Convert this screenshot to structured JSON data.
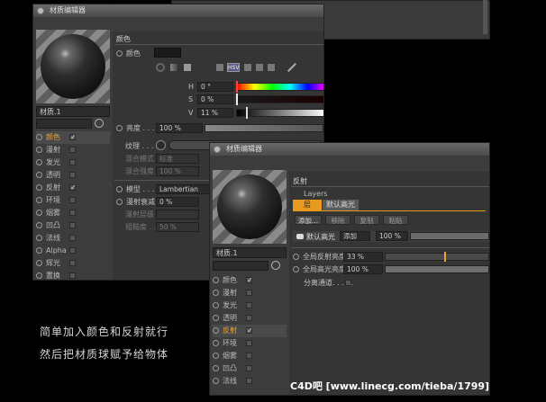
{
  "caption": {
    "line1": "简单加入颜色和反射就行",
    "line2": "然后把材质球赋予给物体"
  },
  "watermark": "C4D吧  [www.linecg.com/tieba/1799]",
  "colors": {
    "accent": "#e8a23a",
    "orange_tab": "#e89a1e"
  },
  "win1": {
    "title": "材质编辑器",
    "material_name": "材质.1",
    "channels": [
      {
        "label": "颜色",
        "checked": true,
        "on": true
      },
      {
        "label": "漫射",
        "checked": false,
        "on": false
      },
      {
        "label": "发光",
        "checked": false,
        "on": false
      },
      {
        "label": "透明",
        "checked": false,
        "on": false
      },
      {
        "label": "反射",
        "checked": true,
        "on": false
      },
      {
        "label": "环境",
        "checked": false,
        "on": false
      },
      {
        "label": "烟雾",
        "checked": false,
        "on": false
      },
      {
        "label": "凹凸",
        "checked": false,
        "on": false
      },
      {
        "label": "法线",
        "checked": false,
        "on": false
      },
      {
        "label": "Alpha",
        "checked": false,
        "on": false
      },
      {
        "label": "辉光",
        "checked": false,
        "on": false
      },
      {
        "label": "置换",
        "checked": false,
        "on": false
      }
    ],
    "section_title": "颜色",
    "color_label": "颜色",
    "hsv_label": "HSV",
    "h_label": "H",
    "h_value": "0 °",
    "s_label": "S",
    "s_value": "0 %",
    "v_label": "V",
    "v_value": "11 %",
    "brightness_label": "亮度 . . .",
    "brightness_value": "100 %",
    "texture_label": "纹理 . . . . .",
    "mix_mode_label": "混合模式",
    "mix_mode_value": "标准",
    "mix_strength_label": "混合强度",
    "mix_strength_value": "100 %",
    "model_label": "模型 . . .",
    "model_value": "Lambertian",
    "diffuse_falloff_label": "漫射衰减",
    "diffuse_falloff_value": "0 %",
    "diffuse_level_label": "漫射层级",
    "roughness_label": "粗糙度 . .",
    "roughness_value": "50 %"
  },
  "win2": {
    "title": "材质编辑器",
    "material_name": "材质.1",
    "channels": [
      {
        "label": "颜色",
        "checked": true,
        "on": false
      },
      {
        "label": "漫射",
        "checked": false,
        "on": false
      },
      {
        "label": "发光",
        "checked": false,
        "on": false
      },
      {
        "label": "透明",
        "checked": false,
        "on": false
      },
      {
        "label": "反射",
        "checked": true,
        "on": true
      },
      {
        "label": "环境",
        "checked": false,
        "on": false
      },
      {
        "label": "烟雾",
        "checked": false,
        "on": false
      },
      {
        "label": "凹凸",
        "checked": false,
        "on": false
      },
      {
        "label": "法线",
        "checked": false,
        "on": false
      }
    ],
    "section_title": "反射",
    "layers_label": "Layers",
    "tab_layer": "层",
    "tab_default_spec": "默认高光",
    "add_btn": "添加...",
    "remove_btn": "移除",
    "copy_btn": "复制",
    "paste_btn": "粘贴",
    "default_spec_label": "默认高光",
    "add_mode": "添加",
    "add_mode_value": "100 %",
    "global_refl_label": "全局反射亮度",
    "global_refl_value": "33 %",
    "global_spec_label": "全局高光亮度",
    "global_spec_value": "100 %",
    "separate_label": "分离通道. . . . ."
  }
}
